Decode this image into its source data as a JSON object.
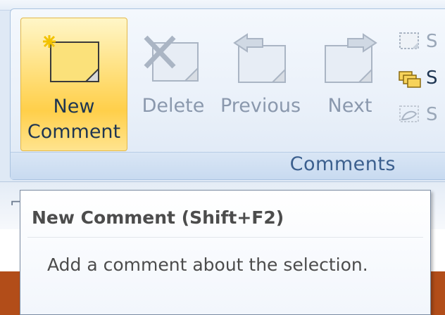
{
  "ribbon": {
    "group_label": "Comments",
    "buttons": {
      "new_comment": {
        "line1": "New",
        "line2": "Comment"
      },
      "delete": "Delete",
      "previous": "Previous",
      "next": "Next"
    },
    "small_buttons": [
      "S",
      "S",
      "S"
    ]
  },
  "tooltip": {
    "title": "New Comment (Shift+F2)",
    "description": "Add a comment about the selection."
  },
  "colors": {
    "accent_highlight": "#ffcf4a",
    "group_label": "#3b5f8e",
    "document_band": "#b24d19"
  },
  "icons": [
    "new-comment-icon",
    "delete-comment-icon",
    "previous-comment-icon",
    "next-comment-icon",
    "show-markup-icon",
    "show-all-comments-icon",
    "show-inked-comments-icon"
  ]
}
